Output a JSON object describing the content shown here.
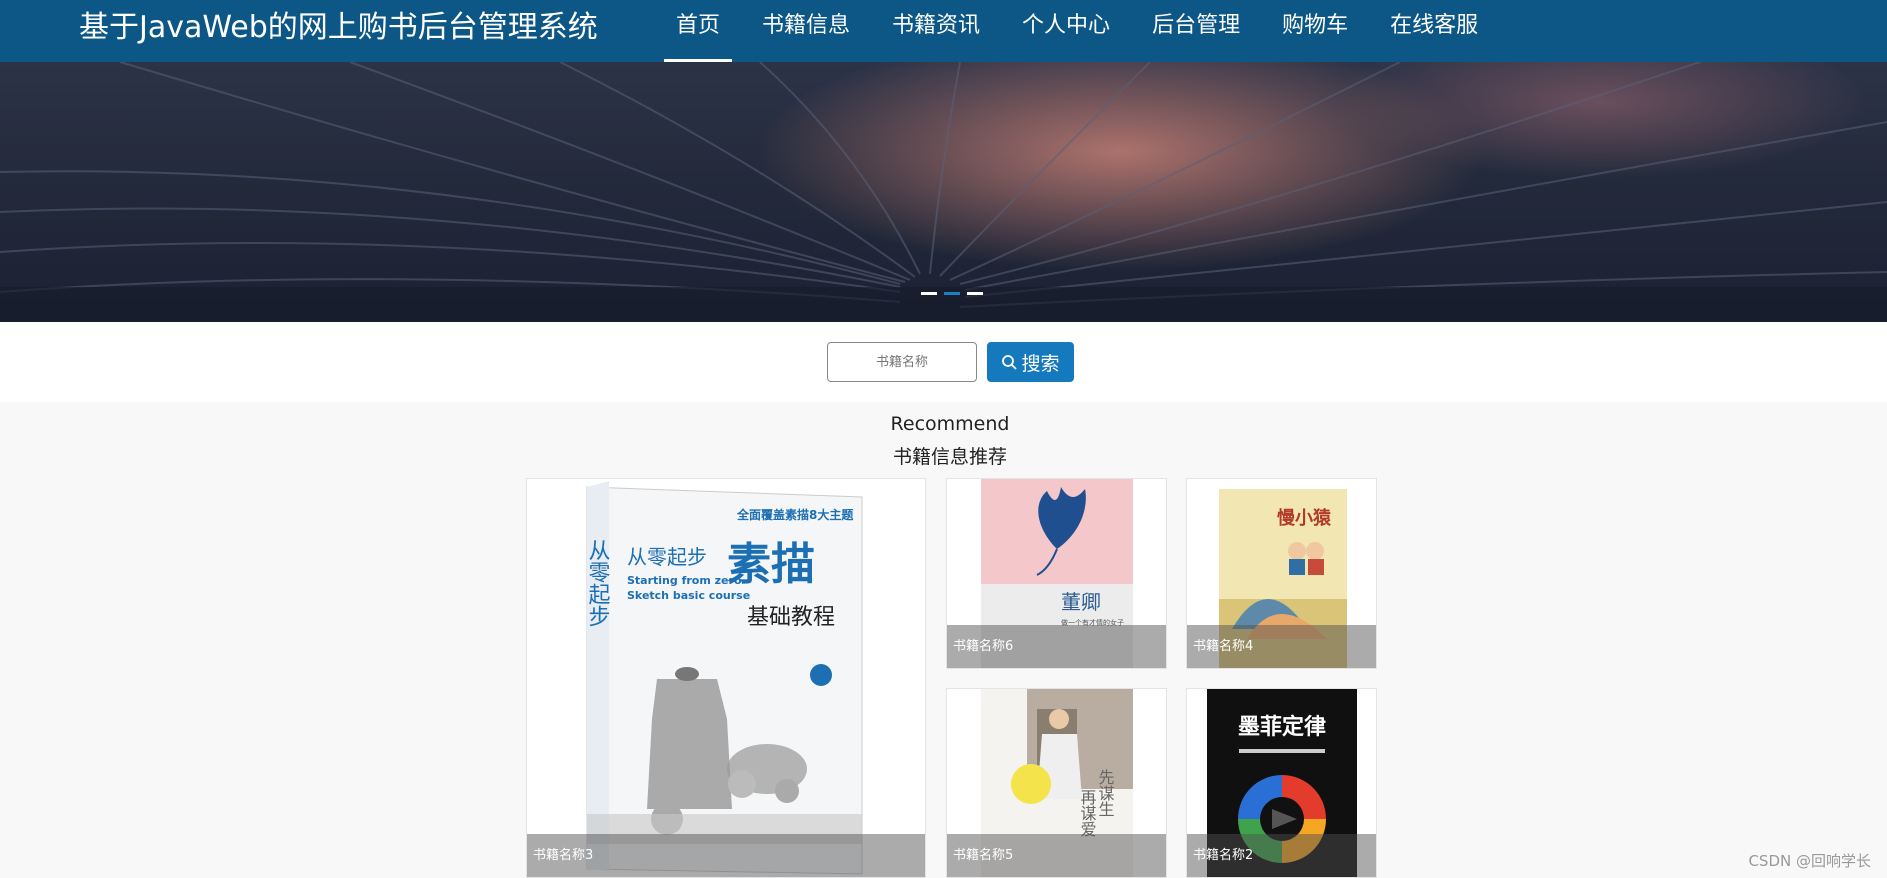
{
  "header": {
    "title": "基于JavaWeb的网上购书后台管理系统",
    "nav": [
      {
        "label": "首页",
        "active": true
      },
      {
        "label": "书籍信息"
      },
      {
        "label": "书籍资讯"
      },
      {
        "label": "个人中心"
      },
      {
        "label": "后台管理"
      },
      {
        "label": "购物车"
      },
      {
        "label": "在线客服"
      }
    ]
  },
  "banner": {
    "slides": 3,
    "active_slide": 2
  },
  "search": {
    "placeholder": "书籍名称",
    "button_label": "搜索"
  },
  "recommend": {
    "title_en": "Recommend",
    "title_cn": "书籍信息推荐",
    "books": [
      {
        "name": "书籍名称3",
        "cover_text": [
          "从零起步",
          "素描",
          "基础教程",
          "Starting from zero",
          "Sketch basic course",
          "全面覆盖素描8大主题"
        ]
      },
      {
        "name": "书籍名称6",
        "cover_text": [
          "董卿",
          "做一个有才情的女子"
        ]
      },
      {
        "name": "书籍名称4",
        "cover_text": [
          "慢小猿"
        ]
      },
      {
        "name": "书籍名称5",
        "cover_text": [
          "先谋生",
          "再谋爱"
        ]
      },
      {
        "name": "书籍名称2",
        "cover_text": [
          "墨菲定律"
        ]
      }
    ]
  },
  "watermark": "CSDN @回响学长",
  "colors": {
    "header": "#0c5786",
    "accent": "#1579bd"
  }
}
